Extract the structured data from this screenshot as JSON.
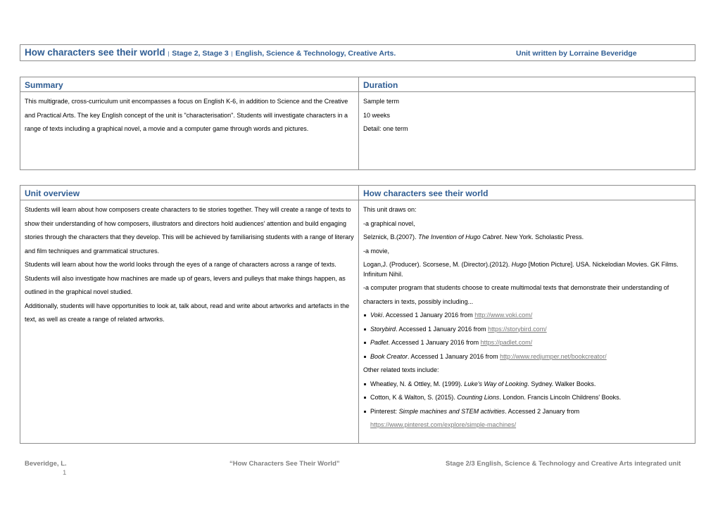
{
  "header": {
    "title": "How characters see their world",
    "separator": "|",
    "stages": "Stage 2, Stage 3",
    "subjects": "English, Science & Technology, Creative Arts.",
    "author": "Unit written by Lorraine Beveridge"
  },
  "summary": {
    "heading": "Summary",
    "text": "This multigrade, cross-curriculum unit encompasses a focus on English K-6, in addition to Science and the Creative and Practical Arts. The key English concept of the unit is \"characterisation\". Students will investigate characters in a range of texts including a graphical novel, a movie and a computer game through words and pictures."
  },
  "duration": {
    "heading": "Duration",
    "lines": [
      "Sample term",
      "10 weeks",
      "Detail: one term"
    ]
  },
  "unit_overview": {
    "heading": "Unit overview",
    "paragraphs": [
      "Students will learn about how composers create characters to tie stories together. They will create a range of texts to show their understanding of how composers, illustrators and directors hold audiences' attention and build engaging stories through the characters that they develop. This will be achieved by familiarising students with a range of literary and film techniques and grammatical structures.",
      "Students will learn about how the world looks through the eyes of a range of characters across a range of texts. Students will also investigate how machines are made up of gears, levers and pulleys that make things happen, as outlined in the graphical novel studied.",
      "Additionally, students will have opportunities to look at, talk about, read and write about artworks and artefacts in the text, as well as create a range of related artworks."
    ]
  },
  "resources": {
    "heading": "How characters see their world",
    "intro": "This unit draws on:",
    "novel_label": "-a graphical novel,",
    "novel_ref": {
      "pre": "Selznick, B.(2007). ",
      "title": "The Invention of Hugo Cabret",
      "post": ". New York. Scholastic Press."
    },
    "movie_label": "-a movie,",
    "movie_ref": {
      "pre": "Logan,J. (Producer). Scorsese, M. (Director).(2012). ",
      "title": "Hugo",
      "post": " [Motion Picture]. USA. Nickelodian Movies. GK Films. Infinitum Nihil."
    },
    "program_label": "-a computer program that students choose to create multimodal texts that demonstrate their understanding of characters in texts, possibly including...",
    "programs": [
      {
        "title": "Voki",
        "text": ". Accessed 1 January 2016 from ",
        "url": "http://www.voki.com/"
      },
      {
        "title": "Storybird",
        "text": ". Accessed 1 January 2016 from ",
        "url": "https://storybird.com/"
      },
      {
        "title": "Padlet",
        "text": ". Accessed 1 January 2016 from ",
        "url": "https://padlet.com/"
      },
      {
        "title": "Book Creator",
        "text": ". Accessed 1 January 2016 from ",
        "url": "http://www.redjumper.net/bookcreator/"
      }
    ],
    "other_label": "Other related texts include:",
    "other": [
      {
        "pre": "Wheatley, N. & Ottley, M. (1999). ",
        "title": "Luke's Way of Looking",
        "post": ". Sydney. Walker Books.",
        "url": ""
      },
      {
        "pre": "Cotton, K & Walton, S. (2015). ",
        "title": "Counting Lions",
        "post": ". London. Francis Lincoln Childrens' Books.",
        "url": ""
      },
      {
        "pre": "Pinterest: ",
        "title": "Simple machines and STEM activities",
        "post": ". Accessed 2 January from ",
        "url": "https://www.pinterest.com/explore/simple-machines/"
      }
    ]
  },
  "footer": {
    "author": "Beveridge, L.",
    "page": "1",
    "title": "“How Characters See Their World”",
    "unit": "Stage 2/3 English, Science & Technology and Creative Arts integrated unit"
  }
}
